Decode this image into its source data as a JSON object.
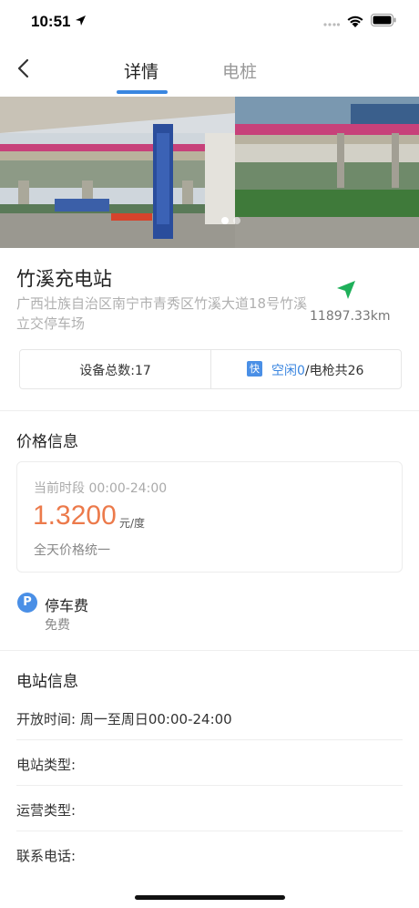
{
  "status_bar": {
    "time": "10:51"
  },
  "nav": {
    "tabs": [
      {
        "label": "详情",
        "active": true
      },
      {
        "label": "电桩",
        "active": false
      }
    ]
  },
  "photo": {
    "slides": 2,
    "active_slide": 1
  },
  "station": {
    "name": "竹溪充电站",
    "address": "广西壮族自治区南宁市青秀区竹溪大道18号竹溪立交停车场",
    "distance": "11897.33km"
  },
  "summary": {
    "device_total_label": "设备总数:",
    "device_total": "17",
    "fast_badge": "快",
    "idle_label": "空闲",
    "idle_count": "0",
    "gun_total_text": "/电枪共26"
  },
  "price": {
    "section_title": "价格信息",
    "period_label": "当前时段",
    "period": "00:00-24:00",
    "value": "1.3200",
    "unit": "元/度",
    "note": "全天价格统一"
  },
  "parking": {
    "icon_letter": "P",
    "title": "停车费",
    "value": "免费"
  },
  "station_info": {
    "section_title": "电站信息",
    "rows": [
      {
        "label": "开放时间:",
        "value": "周一至周日00:00-24:00"
      },
      {
        "label": "电站类型:",
        "value": ""
      },
      {
        "label": "运营类型:",
        "value": ""
      },
      {
        "label": "联系电话:",
        "value": ""
      }
    ]
  },
  "colors": {
    "accent": "#3a86e0",
    "price": "#ec7a4b",
    "nav_arrow": "#1fb05a",
    "badge": "#4a8fe6"
  }
}
